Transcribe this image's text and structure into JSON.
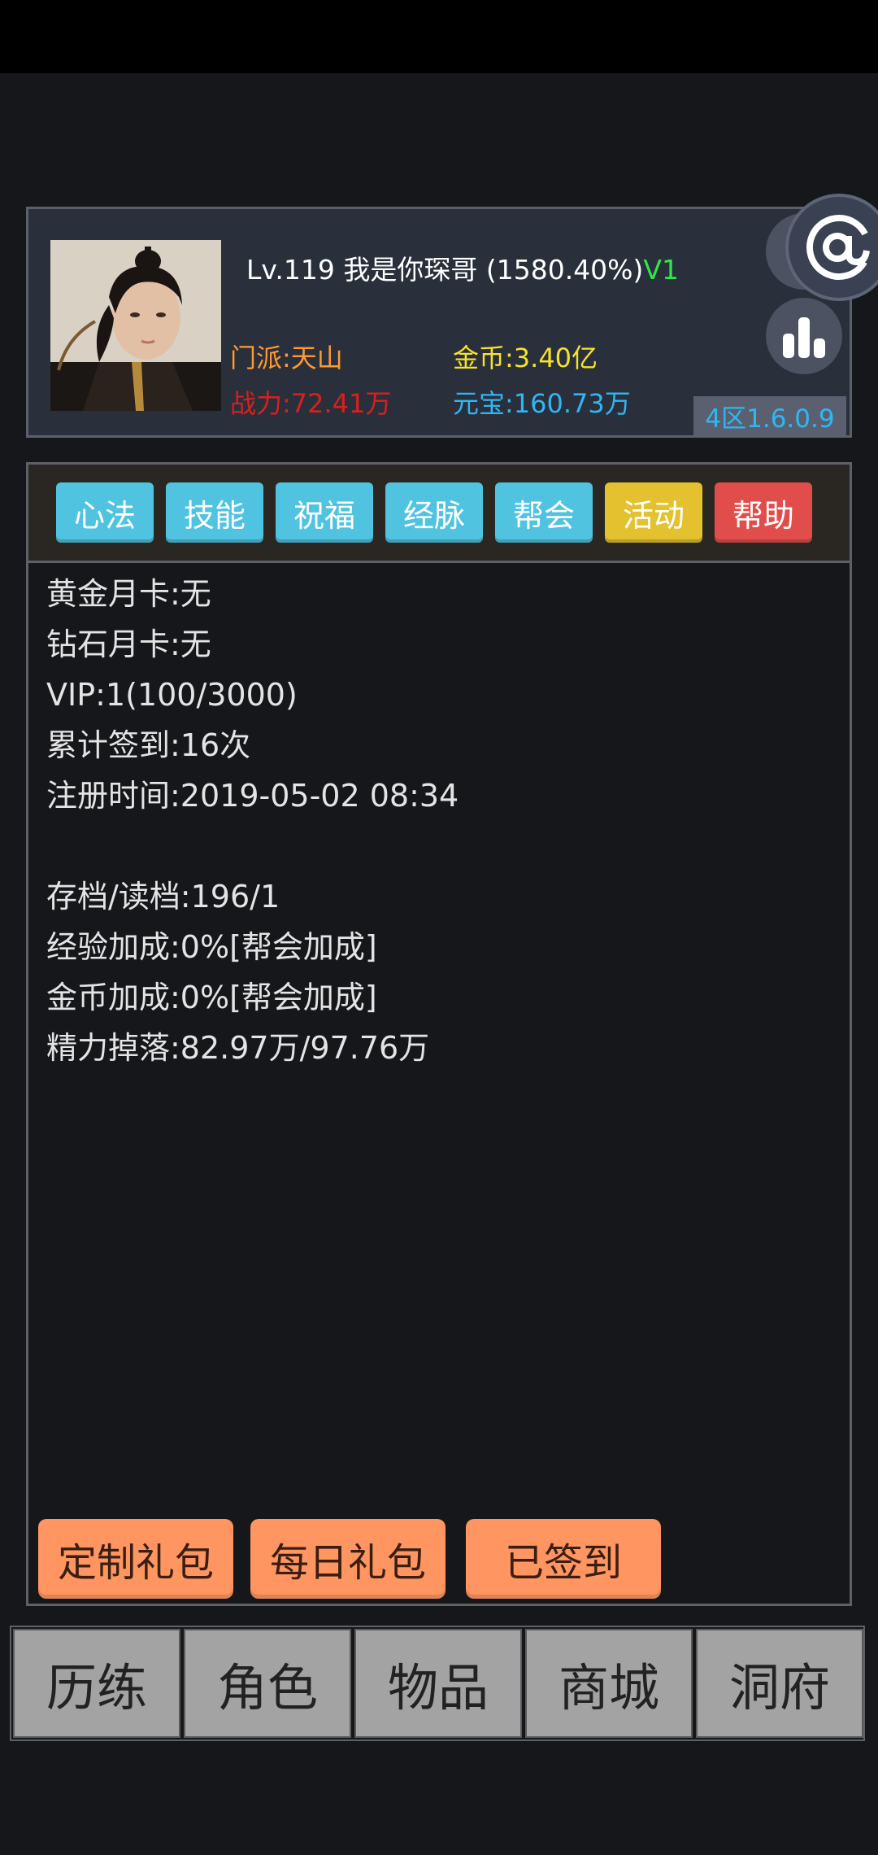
{
  "header": {
    "level": "Lv.119",
    "name": "我是你琛哥",
    "percent": "(1580.40%)",
    "vip_tag": "V1",
    "sect": "门派:天山",
    "power": "战力:72.41万",
    "gold": "金币:3.40亿",
    "ingot": "元宝:160.73万",
    "server": "4区1.6.0.9"
  },
  "tabs": [
    {
      "label": "心法",
      "color": "#4fc3e0"
    },
    {
      "label": "技能",
      "color": "#4fc3e0"
    },
    {
      "label": "祝福",
      "color": "#4fc3e0"
    },
    {
      "label": "经脉",
      "color": "#4fc3e0"
    },
    {
      "label": "帮会",
      "color": "#4fc3e0"
    },
    {
      "label": "活动",
      "color": "#e4c12e"
    },
    {
      "label": "帮助",
      "color": "#e14d4b"
    }
  ],
  "info": {
    "gold_card": "黄金月卡:无",
    "diamond_card": "钻石月卡:无",
    "vip": "VIP:1(100/3000)",
    "signin_total": "累计签到:16次",
    "register_time": "注册时间:2019-05-02 08:34",
    "save_load": "存档/读档:196/1",
    "exp_bonus": "经验加成:0%[帮会加成]",
    "gold_bonus": "金币加成:0%[帮会加成]",
    "energy_drop": "精力掉落:82.97万/97.76万"
  },
  "actions": {
    "custom_pack": "定制礼包",
    "daily_pack": "每日礼包",
    "signed_in": "已签到"
  },
  "nav": [
    {
      "label": "历练"
    },
    {
      "label": "角色"
    },
    {
      "label": "物品"
    },
    {
      "label": "商城"
    },
    {
      "label": "洞府"
    }
  ],
  "colors": {
    "background": "#16171b",
    "header_panel": "#2a2f3c",
    "tab_blue": "#4fc3e0",
    "tab_yellow": "#e4c12e",
    "tab_red": "#e14d4b",
    "action_orange": "#ff9561",
    "nav_gray": "#a3a3a3",
    "vip_green": "#2ee84a",
    "sect_orange": "#ff9a33",
    "power_red": "#d8201e",
    "gold_yellow": "#f5e22b",
    "ingot_blue": "#30b6f3"
  },
  "icons": [
    "settings-gear-icon",
    "bar-chart-icon",
    "at-sign-icon"
  ]
}
